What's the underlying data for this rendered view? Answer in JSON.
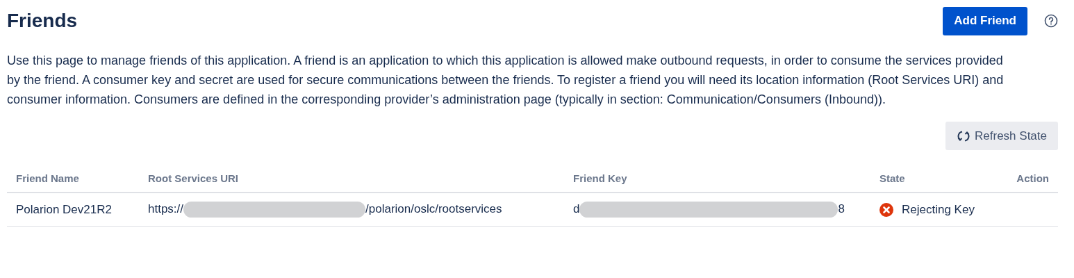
{
  "title": "Friends",
  "add_button": "Add Friend",
  "description": "Use this page to manage friends of this application. A friend is an application to which this application is allowed make outbound requests, in order to consume the services provided by the friend. A consumer key and secret are used for secure communications between the friends. To register a friend you will need its location information (Root Services URI) and consumer information. Consumers are defined in the corresponding provider’s administration page (typically in section: Communication/Consumers (Inbound)).",
  "refresh_button": "Refresh State",
  "table": {
    "columns": [
      "Friend Name",
      "Root Services URI",
      "Friend Key",
      "State",
      "Action"
    ],
    "rows": [
      {
        "name": "Polarion Dev21R2",
        "uri": {
          "before": "https://",
          "after": "/polarion/oslc/rootservices",
          "redacted": true
        },
        "key": {
          "before": "d",
          "after": "8",
          "redacted": true
        },
        "state": {
          "kind": "error",
          "label": "Rejecting Key"
        }
      }
    ]
  }
}
